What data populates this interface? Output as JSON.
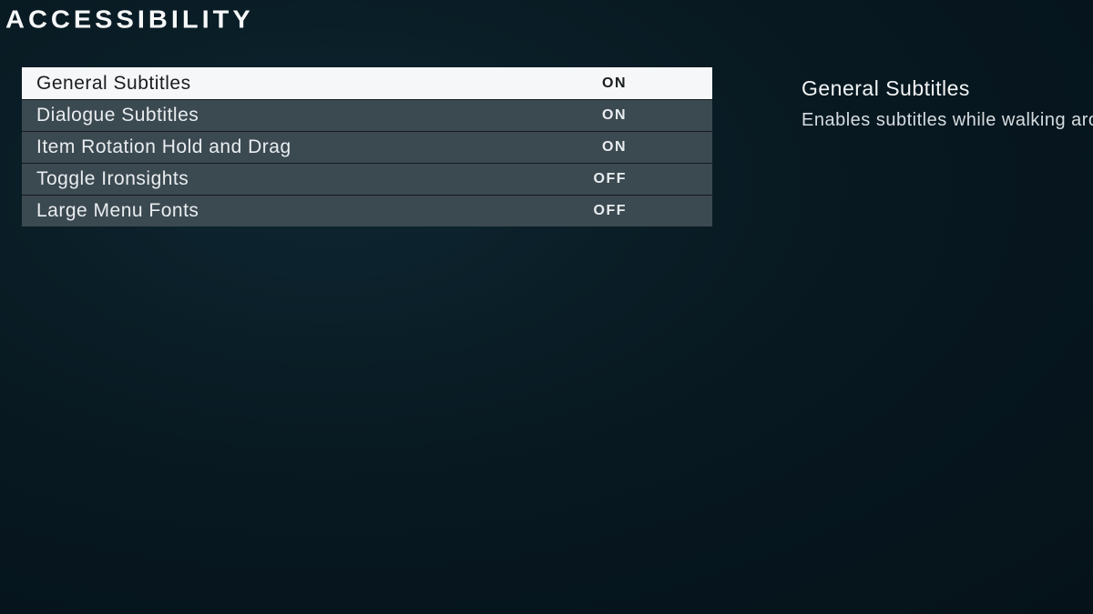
{
  "header": {
    "title": "ACCESSIBILITY"
  },
  "options": [
    {
      "label": "General Subtitles",
      "value": "ON",
      "selected": true
    },
    {
      "label": "Dialogue Subtitles",
      "value": "ON",
      "selected": false
    },
    {
      "label": "Item Rotation Hold and Drag",
      "value": "ON",
      "selected": false
    },
    {
      "label": "Toggle Ironsights",
      "value": "OFF",
      "selected": false
    },
    {
      "label": "Large Menu Fonts",
      "value": "OFF",
      "selected": false
    }
  ],
  "detail": {
    "title": "General Subtitles",
    "description": "Enables subtitles while walking aro"
  }
}
